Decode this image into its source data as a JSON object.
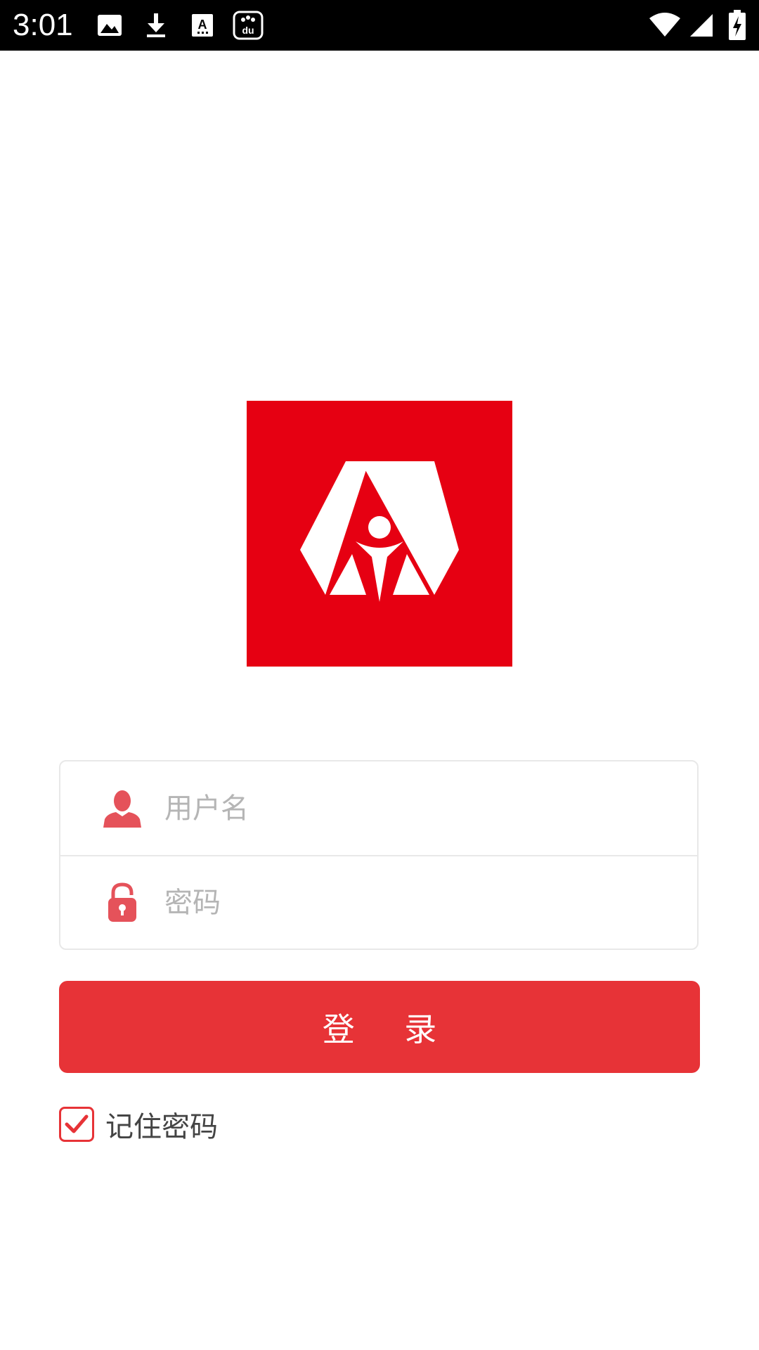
{
  "status_bar": {
    "time": "3:01",
    "icons": [
      "image-icon",
      "download-icon",
      "font-icon",
      "baidu-icon",
      "wifi-icon",
      "signal-icon",
      "battery-charging-icon"
    ]
  },
  "logo": {
    "name": "app-logo",
    "background": "#e60012"
  },
  "login_form": {
    "username": {
      "icon": "user-icon",
      "placeholder": "用户名",
      "value": ""
    },
    "password": {
      "icon": "lock-icon",
      "placeholder": "密码",
      "value": ""
    },
    "submit_label": "登 录",
    "remember": {
      "label": "记住密码",
      "checked": true
    }
  },
  "colors": {
    "accent": "#e73337",
    "logo_red": "#e60012",
    "border": "#e8e8e8",
    "placeholder": "#b5b5b5"
  }
}
